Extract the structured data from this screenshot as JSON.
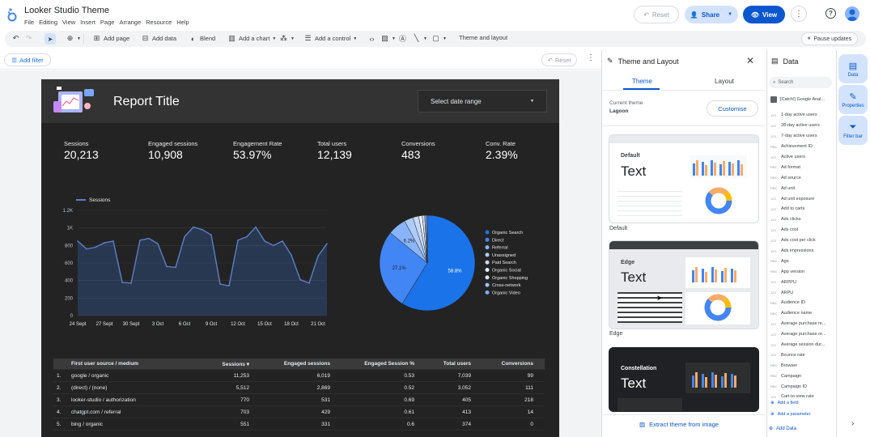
{
  "app": {
    "title": "Looker Studio Theme",
    "menu": [
      "File",
      "Editing",
      "View",
      "Insert",
      "Page",
      "Arrange",
      "Resource",
      "Help"
    ]
  },
  "header": {
    "reset": "Reset",
    "share": "Share",
    "view": "View"
  },
  "toolbar": {
    "add_page": "Add page",
    "add_data": "Add data",
    "blend": "Blend",
    "add_chart": "Add a chart",
    "add_control": "Add a control",
    "theme_layout": "Theme and layout",
    "pause": "Pause updates"
  },
  "filterbar": {
    "add_filter": "Add filter",
    "reset": "Reset"
  },
  "report": {
    "title": "Report Title",
    "date_range": "Select date range",
    "kpis": [
      {
        "label": "Sessions",
        "value": "20,213"
      },
      {
        "label": "Engaged sessions",
        "value": "10,908"
      },
      {
        "label": "Engagement Rate",
        "value": "53.97%"
      },
      {
        "label": "Total users",
        "value": "12,139"
      },
      {
        "label": "Conversions",
        "value": "483"
      },
      {
        "label": "Conv. Rate",
        "value": "2.39%"
      }
    ],
    "table": {
      "headers": [
        "",
        "First user source / medium",
        "Sessions ▾",
        "Engaged sessions",
        "Engaged Session %",
        "Total users",
        "Conversions"
      ],
      "rows": [
        [
          "1.",
          "google / organic",
          "11,253",
          "6,019",
          "0.53",
          "7,039",
          "99"
        ],
        [
          "2.",
          "(direct) / (none)",
          "5,512",
          "2,869",
          "0.52",
          "3,052",
          "111"
        ],
        [
          "3.",
          "looker-studio / authorization",
          "770",
          "531",
          "0.69",
          "405",
          "218"
        ],
        [
          "4.",
          "chatgpt.com / referral",
          "703",
          "429",
          "0.61",
          "413",
          "14"
        ],
        [
          "5.",
          "bing / organic",
          "551",
          "331",
          "0.6",
          "374",
          "0"
        ]
      ]
    }
  },
  "chart_data": [
    {
      "type": "line",
      "title": "",
      "legend": [
        "Sessions"
      ],
      "xlabel": "",
      "ylabel": "",
      "x": [
        "24 Sept",
        "25 Sept",
        "26 Sept",
        "27 Sept",
        "28 Sept",
        "29 Sept",
        "30 Sept",
        "1 Oct",
        "2 Oct",
        "3 Oct",
        "4 Oct",
        "5 Oct",
        "6 Oct",
        "7 Oct",
        "8 Oct",
        "9 Oct",
        "10 Oct",
        "11 Oct",
        "12 Oct",
        "13 Oct",
        "14 Oct",
        "15 Oct",
        "16 Oct",
        "17 Oct",
        "18 Oct",
        "19 Oct",
        "20 Oct",
        "21 Oct",
        "22 Oct"
      ],
      "x_tick_labels": [
        "24 Sept",
        "27 Sept",
        "30 Sept",
        "3 Oct",
        "6 Oct",
        "9 Oct",
        "12 Oct",
        "15 Oct",
        "18 Oct",
        "21 Oct"
      ],
      "y_tick_labels": [
        "0",
        "200",
        "400",
        "600",
        "800",
        "1K",
        "1.2K"
      ],
      "series": [
        {
          "name": "Sessions",
          "values": [
            850,
            760,
            780,
            830,
            850,
            380,
            370,
            860,
            880,
            820,
            560,
            550,
            900,
            1010,
            980,
            920,
            360,
            340,
            860,
            900,
            1010,
            850,
            800,
            850,
            690,
            410,
            370,
            680,
            820
          ]
        }
      ],
      "ylim": [
        0,
        1200
      ]
    },
    {
      "type": "pie",
      "title": "",
      "categories": [
        "Organic Search",
        "Direct",
        "Referral",
        "Unassigned",
        "Paid Search",
        "Organic Social",
        "Organic Shopping",
        "Cross-network",
        "Organic Video"
      ],
      "values": [
        58.8,
        27.1,
        6.2,
        3.0,
        2.0,
        1.2,
        0.8,
        0.5,
        0.4
      ],
      "slice_labels": [
        "58.8%",
        "27.1%",
        "6.2%",
        "",
        "",
        "",
        "",
        "",
        ""
      ],
      "legend_position": "right"
    }
  ],
  "theme_panel": {
    "title": "Theme and Layout",
    "tabs": [
      "Theme",
      "Layout"
    ],
    "current_label": "Current theme",
    "current_value": "Lagoon",
    "customise": "Customise",
    "themes": [
      {
        "name": "Default",
        "sample": "Text"
      },
      {
        "name": "Edge",
        "sample": "Text"
      },
      {
        "name": "Constellation",
        "sample": "Text"
      }
    ],
    "extract": "Extract theme from image"
  },
  "data_panel": {
    "title": "Data",
    "search_placeholder": "Search",
    "source": "[Catch!] Google Anal...",
    "fields": [
      {
        "type": "123",
        "name": "1-day active users"
      },
      {
        "type": "123",
        "name": "28-day active users"
      },
      {
        "type": "123",
        "name": "7-day active users"
      },
      {
        "type": "RBC",
        "name": "Achievement ID"
      },
      {
        "type": "123",
        "name": "Active users"
      },
      {
        "type": "RBC",
        "name": "Ad format"
      },
      {
        "type": "RBC",
        "name": "Ad source"
      },
      {
        "type": "RBC",
        "name": "Ad unit"
      },
      {
        "type": "123",
        "name": "Ad unit exposure"
      },
      {
        "type": "123",
        "name": "Add to carts"
      },
      {
        "type": "123",
        "name": "Ads clicks"
      },
      {
        "type": "123",
        "name": "Ads cost"
      },
      {
        "type": "123",
        "name": "Ads cost per click"
      },
      {
        "type": "123",
        "name": "Ads impressions"
      },
      {
        "type": "RBC",
        "name": "Age"
      },
      {
        "type": "RBC",
        "name": "App version"
      },
      {
        "type": "123",
        "name": "ARPPU"
      },
      {
        "type": "123",
        "name": "ARPU"
      },
      {
        "type": "RBC",
        "name": "Audience ID"
      },
      {
        "type": "RBC",
        "name": "Audience name"
      },
      {
        "type": "123",
        "name": "Average purchase re..."
      },
      {
        "type": "123",
        "name": "Average purchase re..."
      },
      {
        "type": "123",
        "name": "Average session dur..."
      },
      {
        "type": "123",
        "name": "Bounce rate"
      },
      {
        "type": "RBC",
        "name": "Browser"
      },
      {
        "type": "RBC",
        "name": "Campaign"
      },
      {
        "type": "RBC",
        "name": "Campaign ID"
      },
      {
        "type": "123",
        "name": "Cart-to-view rate"
      }
    ],
    "add_field": "Add a field",
    "add_parameter": "Add a parameter",
    "add_data": "Add Data"
  },
  "rail": [
    "Data",
    "Properties",
    "Filter bar"
  ],
  "colors": {
    "accent": "#0b57d0",
    "pie": [
      "#1a73e8",
      "#4285f4",
      "#8ab4f8",
      "#aecbfa",
      "#c6dafc",
      "#e8f0fe",
      "#d2e3fc",
      "#a1c2fa",
      "#7baaf7"
    ],
    "line": "#5b7fc7"
  }
}
